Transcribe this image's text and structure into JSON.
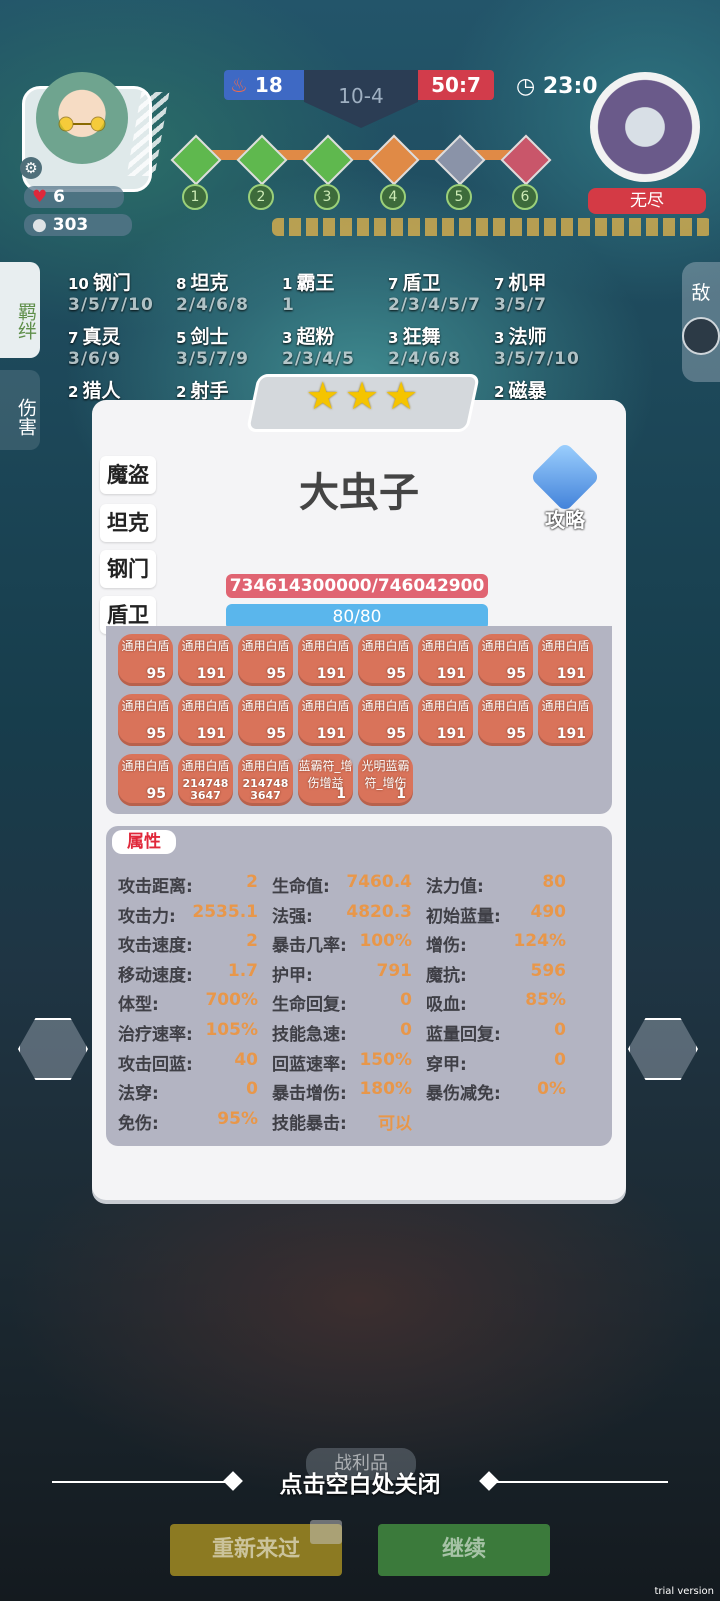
{
  "hud": {
    "player_hp": "6",
    "player_gold": "303",
    "blue_score": "18",
    "round": "10-4",
    "red_score": "50:7",
    "timer": "23:0",
    "enemy_name": "无尽",
    "stages": [
      "1",
      "2",
      "3",
      "4",
      "5",
      "6"
    ],
    "stage_colors": [
      "#5fb84e",
      "#5fb84e",
      "#5fb84e",
      "#e08a46",
      "#8a93a8",
      "#c9566a"
    ]
  },
  "side_tabs": {
    "synergy": "羁绊",
    "damage": "伤害",
    "enemy": "敌"
  },
  "synergies": [
    {
      "count": "10",
      "name": "钢门",
      "levels": "3/5/7/10"
    },
    {
      "count": "8",
      "name": "坦克",
      "levels": "2/4/6/8"
    },
    {
      "count": "1",
      "name": "霸王",
      "levels": "1"
    },
    {
      "count": "7",
      "name": "盾卫",
      "levels": "2/3/4/5/7"
    },
    {
      "count": "7",
      "name": "机甲",
      "levels": "3/5/7"
    },
    {
      "count": "7",
      "name": "真灵",
      "levels": "3/6/9"
    },
    {
      "count": "5",
      "name": "剑士",
      "levels": "3/5/7/9"
    },
    {
      "count": "3",
      "name": "超粉",
      "levels": "2/3/4/5"
    },
    {
      "count": "3",
      "name": "狂舞",
      "levels": "2/4/6/8"
    },
    {
      "count": "3",
      "name": "法师",
      "levels": "3/5/7/10"
    },
    {
      "count": "2",
      "name": "猎人",
      "levels": ""
    },
    {
      "count": "2",
      "name": "射手",
      "levels": ""
    },
    {
      "count": "2",
      "name": "磁暴",
      "levels": ""
    }
  ],
  "modal": {
    "stars": [
      "★",
      "★",
      "★"
    ],
    "unit_name": "大虫子",
    "guide_label": "攻略",
    "traits": [
      "魔盗",
      "坦克",
      "钢门",
      "盾卫"
    ],
    "hp_text": "734614300000/746042900",
    "mp_text": "80/80",
    "items": [
      {
        "name": "通用白盾",
        "value": "95"
      },
      {
        "name": "通用白盾",
        "value": "191"
      },
      {
        "name": "通用白盾",
        "value": "95"
      },
      {
        "name": "通用白盾",
        "value": "191"
      },
      {
        "name": "通用白盾",
        "value": "95"
      },
      {
        "name": "通用白盾",
        "value": "191"
      },
      {
        "name": "通用白盾",
        "value": "95"
      },
      {
        "name": "通用白盾",
        "value": "191"
      },
      {
        "name": "通用白盾",
        "value": "95"
      },
      {
        "name": "通用白盾",
        "value": "191"
      },
      {
        "name": "通用白盾",
        "value": "95"
      },
      {
        "name": "通用白盾",
        "value": "191"
      },
      {
        "name": "通用白盾",
        "value": "95"
      },
      {
        "name": "通用白盾",
        "value": "191"
      },
      {
        "name": "通用白盾",
        "value": "95"
      },
      {
        "name": "通用白盾",
        "value": "191"
      },
      {
        "name": "通用白盾",
        "value": "95"
      },
      {
        "name": "通用白盾",
        "value": "214748 3647"
      },
      {
        "name": "通用白盾",
        "value": "214748 3647"
      },
      {
        "name": "蓝霸符_增伤增益",
        "value": "1"
      },
      {
        "name": "光明蓝霸符_增伤",
        "value": "1"
      }
    ],
    "attr_title": "属性",
    "attributes": [
      {
        "label": "攻击距离:",
        "value": "2"
      },
      {
        "label": "生命值:",
        "value": "7460.4"
      },
      {
        "label": "法力值:",
        "value": "80"
      },
      {
        "label": "攻击力:",
        "value": "2535.1"
      },
      {
        "label": "法强:",
        "value": "4820.3"
      },
      {
        "label": "初始蓝量:",
        "value": "490"
      },
      {
        "label": "攻击速度:",
        "value": "2"
      },
      {
        "label": "暴击几率:",
        "value": "100%"
      },
      {
        "label": "增伤:",
        "value": "124%"
      },
      {
        "label": "移动速度:",
        "value": "1.7"
      },
      {
        "label": "护甲:",
        "value": "791"
      },
      {
        "label": "魔抗:",
        "value": "596"
      },
      {
        "label": "体型:",
        "value": "700%"
      },
      {
        "label": "生命回复:",
        "value": "0"
      },
      {
        "label": "吸血:",
        "value": "85%"
      },
      {
        "label": "治疗速率:",
        "value": "105%"
      },
      {
        "label": "技能急速:",
        "value": "0"
      },
      {
        "label": "蓝量回复:",
        "value": "0"
      },
      {
        "label": "攻击回蓝:",
        "value": "40"
      },
      {
        "label": "回蓝速率:",
        "value": "150%"
      },
      {
        "label": "穿甲:",
        "value": "0"
      },
      {
        "label": "法穿:",
        "value": "0"
      },
      {
        "label": "暴击增伤:",
        "value": "180%"
      },
      {
        "label": "暴伤减免:",
        "value": "0%"
      },
      {
        "label": "免伤:",
        "value": "95%"
      },
      {
        "label": "技能暴击:",
        "value": "可以"
      }
    ]
  },
  "bottom": {
    "loot_label": "战利品",
    "close_hint": "点击空白处关闭",
    "retry_label": "重新来过",
    "continue_label": "继续",
    "trial": "trial version"
  }
}
